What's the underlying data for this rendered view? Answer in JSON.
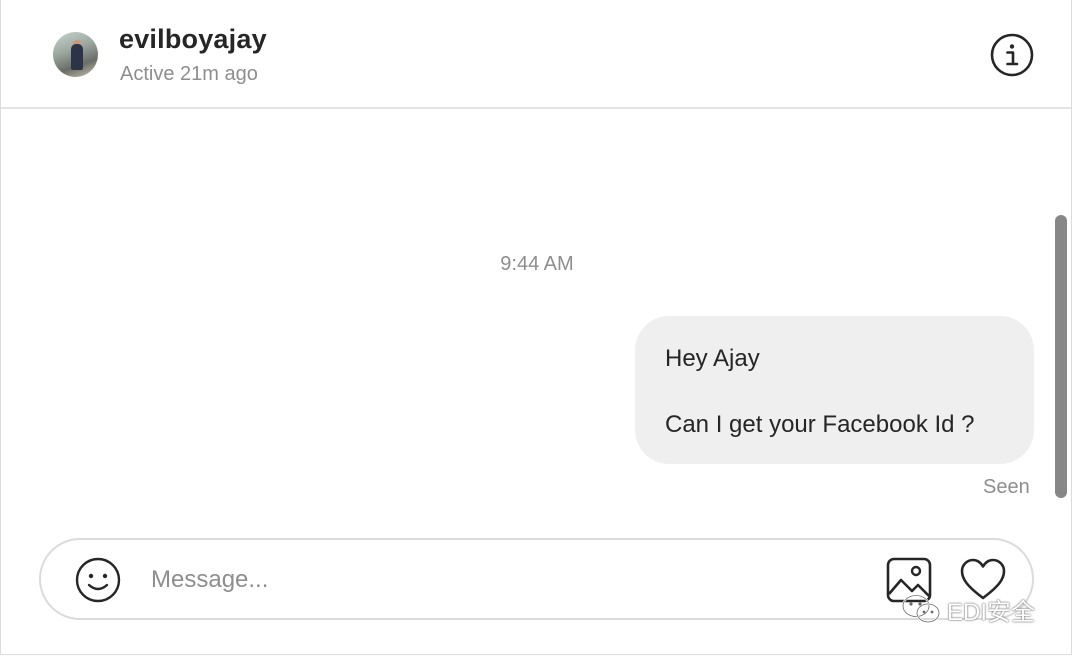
{
  "header": {
    "username": "evilboyajay",
    "status": "Active 21m ago"
  },
  "thread": {
    "timestamp": "9:44 AM",
    "message": {
      "line1": "Hey Ajay",
      "line2": "Can I get your Facebook Id ?"
    },
    "seen_label": "Seen"
  },
  "composer": {
    "placeholder": "Message..."
  },
  "watermark": {
    "text": "EDI安全"
  },
  "icons": {
    "info": "info-icon",
    "emoji": "emoji-icon",
    "image": "image-icon",
    "heart": "heart-icon",
    "watermark_logo": "wechat-icon"
  },
  "colors": {
    "bubble": "#efefef",
    "muted_text": "#8e8e8e",
    "primary_text": "#262626",
    "border": "#dbdbdb"
  }
}
